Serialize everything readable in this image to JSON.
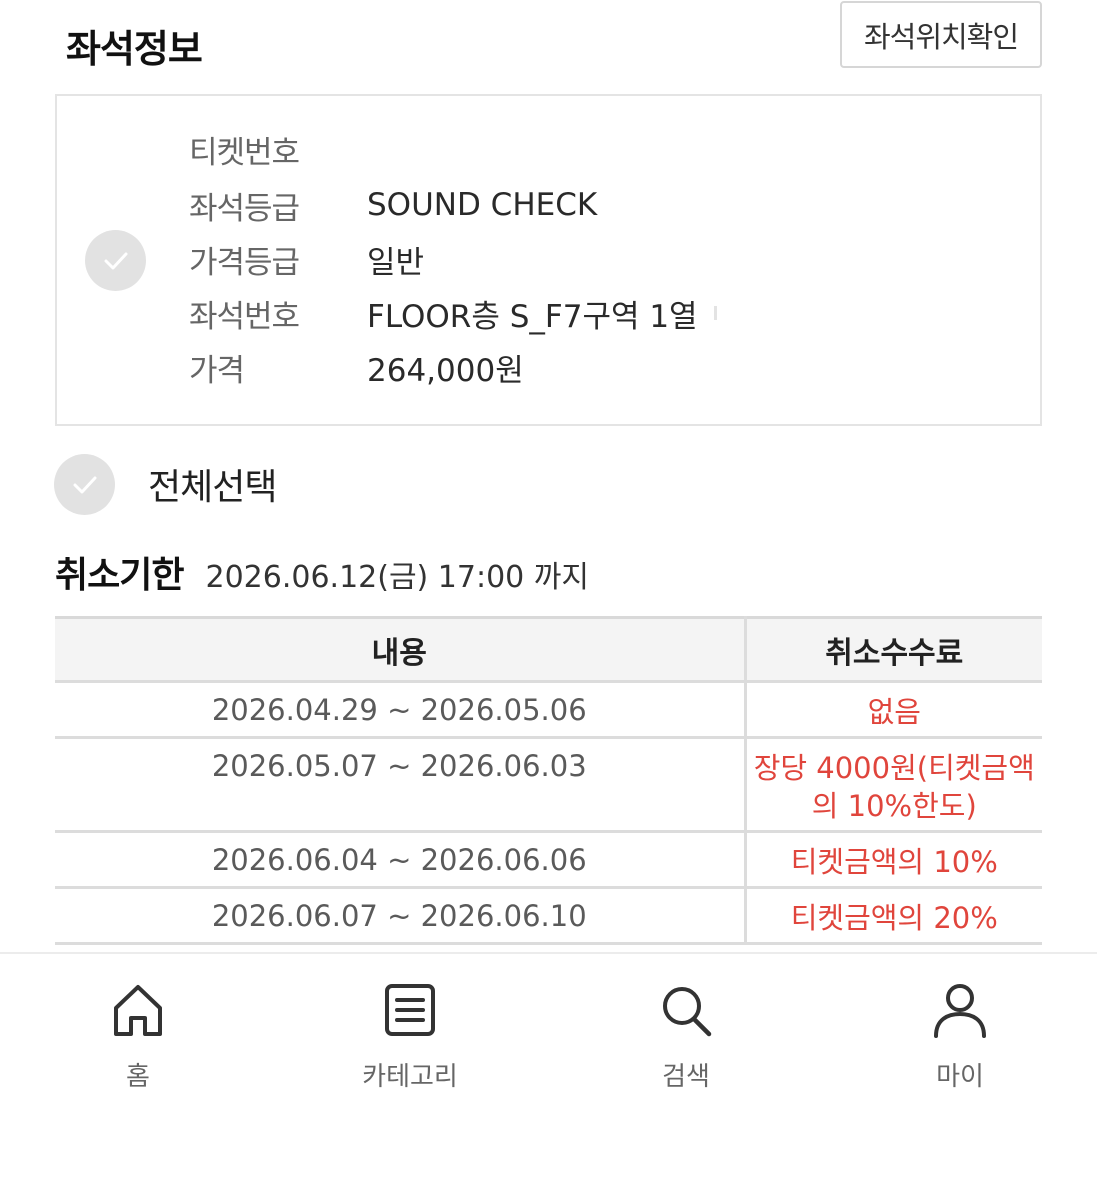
{
  "header": {
    "title": "좌석정보",
    "seat_map_button": "좌석위치확인"
  },
  "ticket": {
    "rows": [
      {
        "label": "티켓번호",
        "value": ""
      },
      {
        "label": "좌석등급",
        "value": "SOUND CHECK"
      },
      {
        "label": "가격등급",
        "value": "일반"
      },
      {
        "label": "좌석번호",
        "value": "FLOOR층 S_F7구역 1열"
      },
      {
        "label": "가격",
        "value": "264,000원"
      }
    ]
  },
  "select_all": {
    "label": "전체선택"
  },
  "deadline": {
    "title": "취소기한",
    "value": "2026.06.12(금) 17:00 까지"
  },
  "fee_table": {
    "headers": [
      "내용",
      "취소수수료"
    ],
    "rows": [
      {
        "period": "2026.04.29 ~ 2026.05.06",
        "fee": "없음"
      },
      {
        "period": "2026.05.07 ~ 2026.06.03",
        "fee": "장당 4000원(티켓금액의 10%한도)"
      },
      {
        "period": "2026.06.04 ~ 2026.06.06",
        "fee": "티켓금액의 10%"
      },
      {
        "period": "2026.06.07 ~ 2026.06.10",
        "fee": "티켓금액의 20%"
      }
    ]
  },
  "colors": {
    "fee_text": "#e0453c",
    "check_circle": "#e2e2e2"
  },
  "bottom_nav": {
    "items": [
      {
        "label": "홈",
        "icon": "home-icon"
      },
      {
        "label": "카테고리",
        "icon": "list-icon"
      },
      {
        "label": "검색",
        "icon": "search-icon"
      },
      {
        "label": "마이",
        "icon": "person-icon"
      }
    ]
  }
}
